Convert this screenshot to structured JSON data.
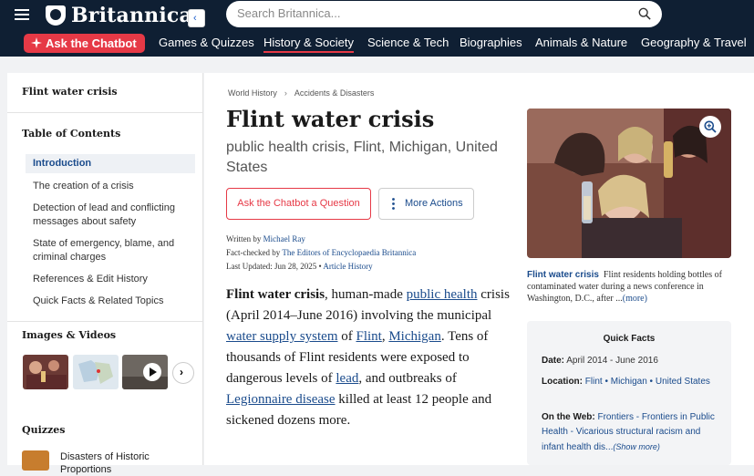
{
  "header": {
    "brand": "Britannica",
    "search_placeholder": "Search Britannica...",
    "chatbot_label": "Ask the Chatbot",
    "nav": [
      "Games & Quizzes",
      "History & Society",
      "Science & Tech",
      "Biographies",
      "Animals & Nature",
      "Geography & Travel"
    ],
    "active_nav": "History & Society"
  },
  "sidebar": {
    "title": "Flint water crisis",
    "toc_heading": "Table of Contents",
    "toc": [
      "Introduction",
      "The creation of a crisis",
      "Detection of lead and conflicting messages about safety",
      "State of emergency, blame, and criminal charges",
      "References & Edit History",
      "Quick Facts & Related Topics"
    ],
    "images_heading": "Images & Videos",
    "quizzes_heading": "Quizzes",
    "quiz_title": "Disasters of Historic Proportions"
  },
  "article": {
    "breadcrumb": [
      "World History",
      "Accidents & Disasters"
    ],
    "title": "Flint water crisis",
    "subtitle": "public health crisis, Flint, Michigan, United States",
    "ask_button": "Ask the Chatbot a Question",
    "more_actions": "More Actions",
    "byline": {
      "written_label": "Written by",
      "author": "Michael Ray",
      "fact_label": "Fact-checked by",
      "fact_checker": "The Editors of Encyclopaedia Britannica",
      "updated_label": "Last Updated: Jun 28, 2025",
      "history_link": "Article History"
    },
    "intro": {
      "bold_term": "Flint water crisis",
      "t1": ", human-made ",
      "l1": "public health",
      "t2": " crisis (April 2014–June 2016) involving the municipal ",
      "l2": "water supply system",
      "t3": " of ",
      "l3": "Flint",
      "t4": ", ",
      "l4": "Michigan",
      "t5": ". Tens of thousands of Flint residents were exposed to dangerous levels of ",
      "l5": "lead",
      "t6": ", and outbreaks of ",
      "l6": "Legionnaire disease",
      "t7": " killed at least 12 people and sickened dozens more."
    },
    "caption": {
      "title": "Flint water crisis",
      "text": "Flint residents holding bottles of contaminated water during a news conference in Washington, D.C., after ...",
      "more": "(more)"
    }
  },
  "quick_facts": {
    "title": "Quick Facts",
    "date_label": "Date:",
    "date_value": "April 2014 - June 2016",
    "location_label": "Location:",
    "location_values": [
      "Flint",
      "Michigan",
      "United States"
    ],
    "location_sep": " • ",
    "web_label": "On the Web:",
    "web_value": "Frontiers - Frontiers in Public Health - Vicarious structural racism and infant health dis...",
    "show_more": "(Show more)"
  },
  "colors": {
    "navy": "#0f1f33",
    "accent_red": "#e63946",
    "link_blue": "#1a4b8c"
  },
  "icons": [
    "hamburger-icon",
    "britannica-thistle-icon",
    "search-icon",
    "sparkle-icon",
    "chevron-left-icon",
    "kebab-icon",
    "zoom-icon",
    "play-icon",
    "chevron-right-icon"
  ]
}
